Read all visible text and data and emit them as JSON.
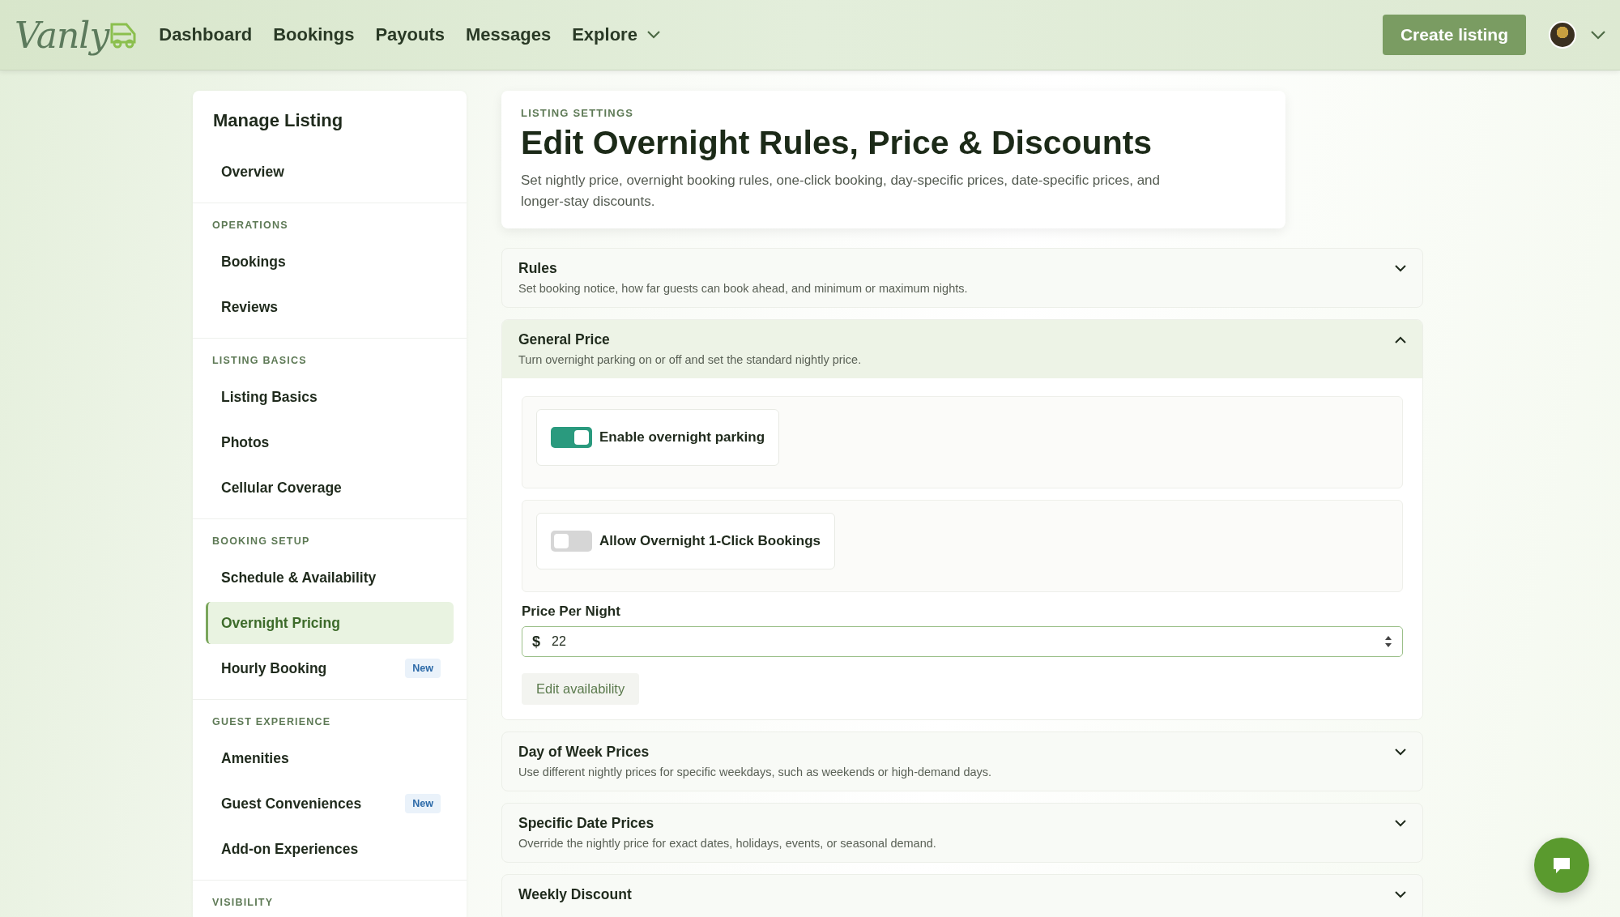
{
  "nav": {
    "logo": "Vanly",
    "links": [
      {
        "label": "Dashboard",
        "kind": "link"
      },
      {
        "label": "Bookings",
        "kind": "link"
      },
      {
        "label": "Payouts",
        "kind": "link"
      },
      {
        "label": "Messages",
        "kind": "link"
      },
      {
        "label": "Explore",
        "kind": "dropdown"
      }
    ],
    "cta": "Create listing"
  },
  "sidebar": {
    "title": "Manage Listing",
    "sections": [
      {
        "items": [
          {
            "label": "Overview",
            "selected": false
          }
        ]
      },
      {
        "heading": "OPERATIONS",
        "items": [
          {
            "label": "Bookings",
            "selected": false
          },
          {
            "label": "Reviews",
            "selected": false
          }
        ]
      },
      {
        "heading": "LISTING BASICS",
        "items": [
          {
            "label": "Listing Basics",
            "selected": false
          },
          {
            "label": "Photos",
            "selected": false
          },
          {
            "label": "Cellular Coverage",
            "selected": false
          }
        ]
      },
      {
        "heading": "BOOKING SETUP",
        "items": [
          {
            "label": "Schedule & Availability",
            "selected": false
          },
          {
            "label": "Overnight Pricing",
            "selected": true
          },
          {
            "label": "Hourly Booking",
            "selected": false,
            "badge": "New"
          }
        ]
      },
      {
        "heading": "GUEST EXPERIENCE",
        "items": [
          {
            "label": "Amenities",
            "selected": false
          },
          {
            "label": "Guest Conveniences",
            "selected": false,
            "badge": "New"
          },
          {
            "label": "Add-on Experiences",
            "selected": false
          }
        ]
      },
      {
        "heading": "VISIBILITY"
      }
    ]
  },
  "header": {
    "eyebrow": "LISTING SETTINGS",
    "title": "Edit Overnight Rules, Price & Discounts",
    "description": "Set nightly price, overnight booking rules, one-click booking, day-specific prices, date-specific prices, and longer-stay discounts."
  },
  "sections": [
    {
      "title": "Rules",
      "description": "Set booking notice, how far guests can book ahead, and minimum or maximum nights.",
      "expanded": false
    },
    {
      "title": "General Price",
      "description": "Turn overnight parking on or off and set the standard nightly price.",
      "expanded": true
    },
    {
      "title": "Day of Week Prices",
      "description": "Use different nightly prices for specific weekdays, such as weekends or high-demand days.",
      "expanded": false
    },
    {
      "title": "Specific Date Prices",
      "description": "Override the nightly price for exact dates, holidays, events, or seasonal demand.",
      "expanded": false
    },
    {
      "title": "Weekly Discount",
      "expanded": false
    }
  ],
  "general_price": {
    "toggles": [
      {
        "label": "Enable overnight parking",
        "on": true
      },
      {
        "label": "Allow Overnight 1-Click Bookings",
        "on": false
      }
    ],
    "price_label": "Price Per Night",
    "currency": "$",
    "value": "22",
    "edit_button": "Edit availability"
  }
}
